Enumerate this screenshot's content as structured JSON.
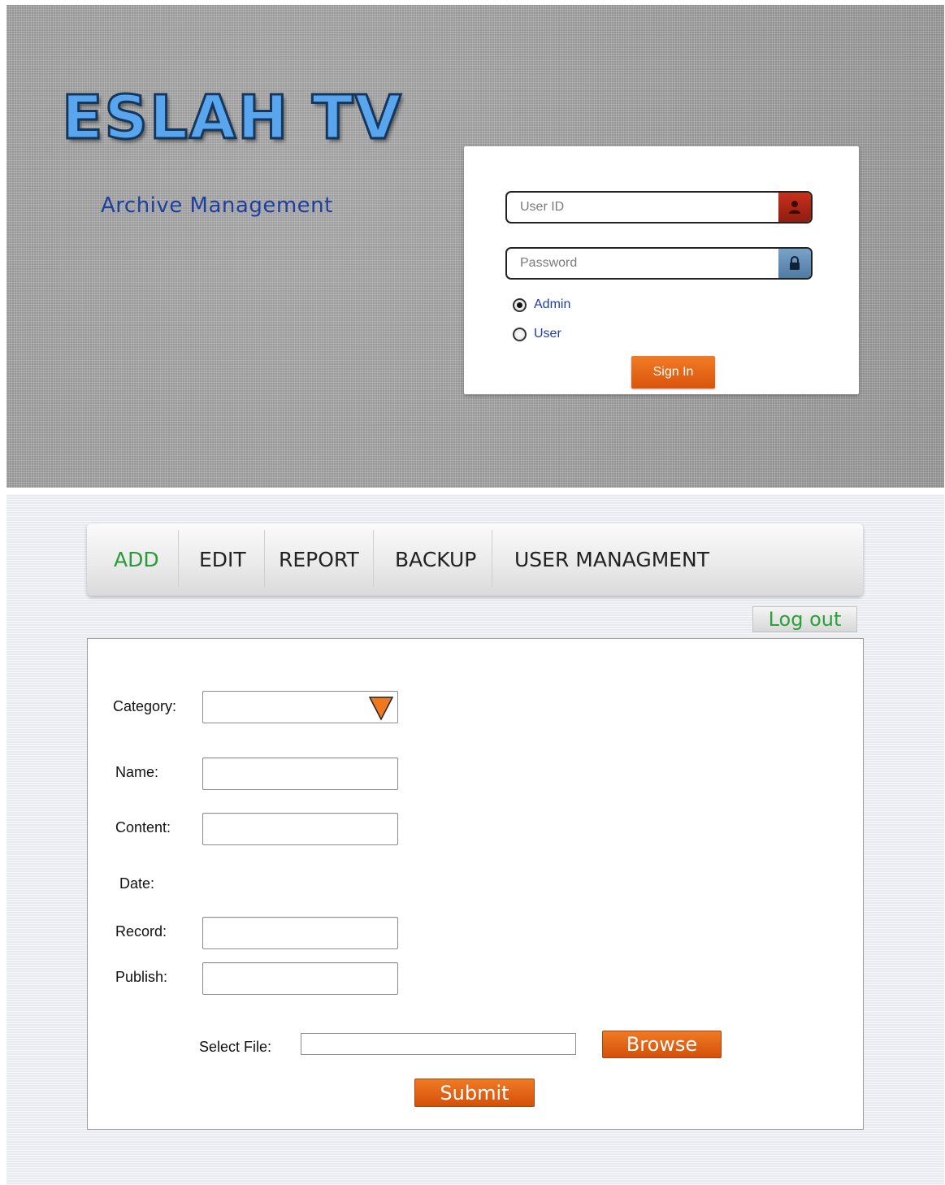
{
  "login": {
    "brand_title": "ESLAH TV",
    "subtitle": "Archive Management",
    "userid_placeholder": "User ID",
    "password_placeholder": "Password",
    "user_icon": "user-icon",
    "lock_icon": "lock-icon",
    "roles": [
      {
        "label": "Admin",
        "checked": true
      },
      {
        "label": "User",
        "checked": false
      }
    ],
    "signin_label": "Sign In"
  },
  "admin": {
    "menu": [
      {
        "label": "ADD",
        "active": true
      },
      {
        "label": "EDIT",
        "active": false
      },
      {
        "label": "REPORT",
        "active": false
      },
      {
        "label": "BACKUP",
        "active": false
      },
      {
        "label": "USER MANAGMENT",
        "active": false
      }
    ],
    "logout_label": "Log out",
    "form": {
      "category_label": "Category:",
      "name_label": "Name:",
      "content_label": "Content:",
      "date_label": "Date:",
      "record_label": "Record:",
      "publish_label": "Publish:",
      "select_file_label": "Select File:",
      "browse_label": "Browse",
      "submit_label": "Submit"
    }
  },
  "colors": {
    "accent_orange": "#e2611a",
    "active_green": "#2a9b3a",
    "brand_blue": "#5aa6ee",
    "subtitle_blue": "#1d3f9e"
  }
}
